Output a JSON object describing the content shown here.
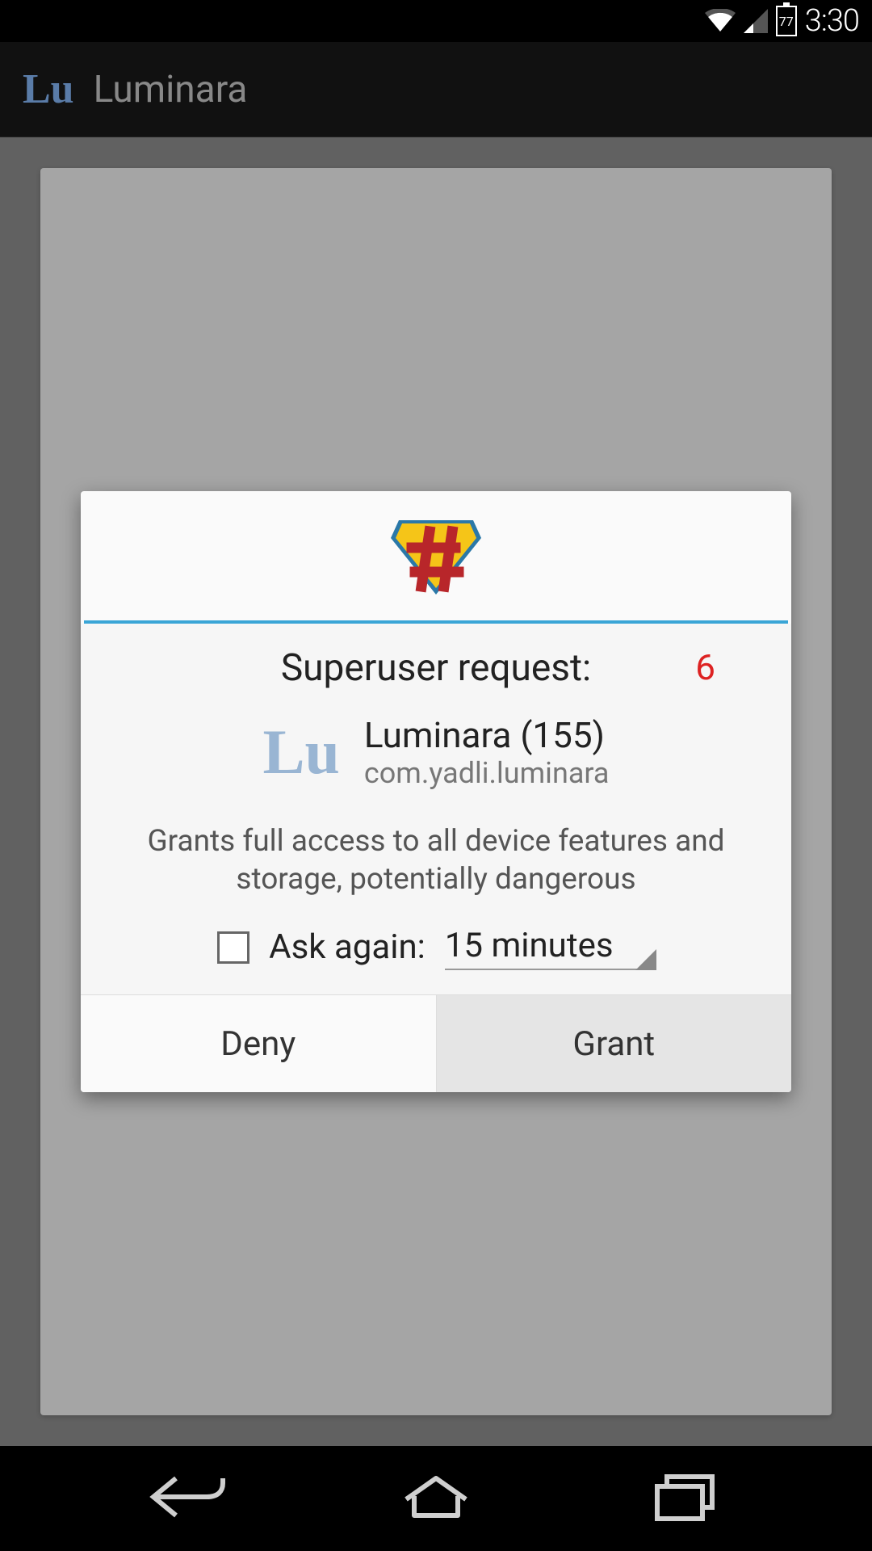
{
  "status_bar": {
    "battery_percent": "77",
    "time": "3:30"
  },
  "action_bar": {
    "icon_text": "Lu",
    "title": "Luminara"
  },
  "dialog": {
    "title": "Superuser request:",
    "countdown": "6",
    "app_icon_text": "Lu",
    "app_name": "Luminara (155)",
    "app_package": "com.yadli.luminara",
    "warning": "Grants full access to all device features and storage, potentially dangerous",
    "ask_again_label": "Ask again:",
    "ask_again_value": "15 minutes",
    "deny_label": "Deny",
    "grant_label": "Grant"
  }
}
